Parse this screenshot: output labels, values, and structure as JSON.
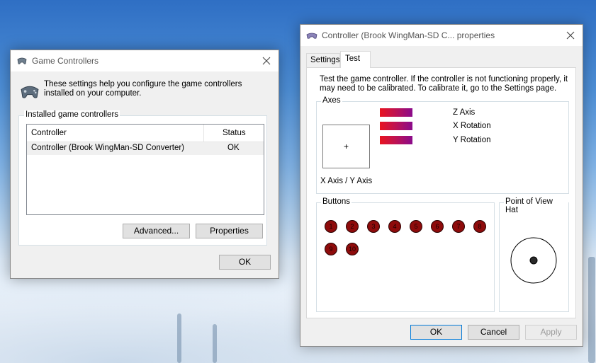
{
  "gc": {
    "title": "Game Controllers",
    "description": "These settings help you configure the game controllers installed on your computer.",
    "installed_label": "Installed game controllers",
    "columns": [
      "Controller",
      "Status"
    ],
    "rows": [
      {
        "controller": "Controller (Brook WingMan-SD Converter)",
        "status": "OK"
      }
    ],
    "advanced_label": "Advanced...",
    "properties_label": "Properties",
    "ok_label": "OK"
  },
  "props": {
    "title": "Controller (Brook WingMan-SD C... properties",
    "tabs": [
      "Settings",
      "Test"
    ],
    "active_tab": "Test",
    "intro": "Test the game controller.  If the controller is not functioning properly, it may need to be calibrated.  To calibrate it, go to the Settings page.",
    "axes_label": "Axes",
    "xy_label": "X Axis / Y Axis",
    "axis_bars": [
      "Z Axis",
      "X Rotation",
      "Y Rotation"
    ],
    "buttons_label": "Buttons",
    "buttons": [
      "1",
      "2",
      "3",
      "4",
      "5",
      "6",
      "7",
      "8",
      "9",
      "10"
    ],
    "pov_label": "Point of View Hat",
    "ok_label": "OK",
    "cancel_label": "Cancel",
    "apply_label": "Apply",
    "colors": {
      "axis_bar_start": "#e8131f",
      "axis_bar_end": "#8a0b8c",
      "button_fill": "#8e0b0b",
      "focus_border": "#0078d7"
    }
  }
}
